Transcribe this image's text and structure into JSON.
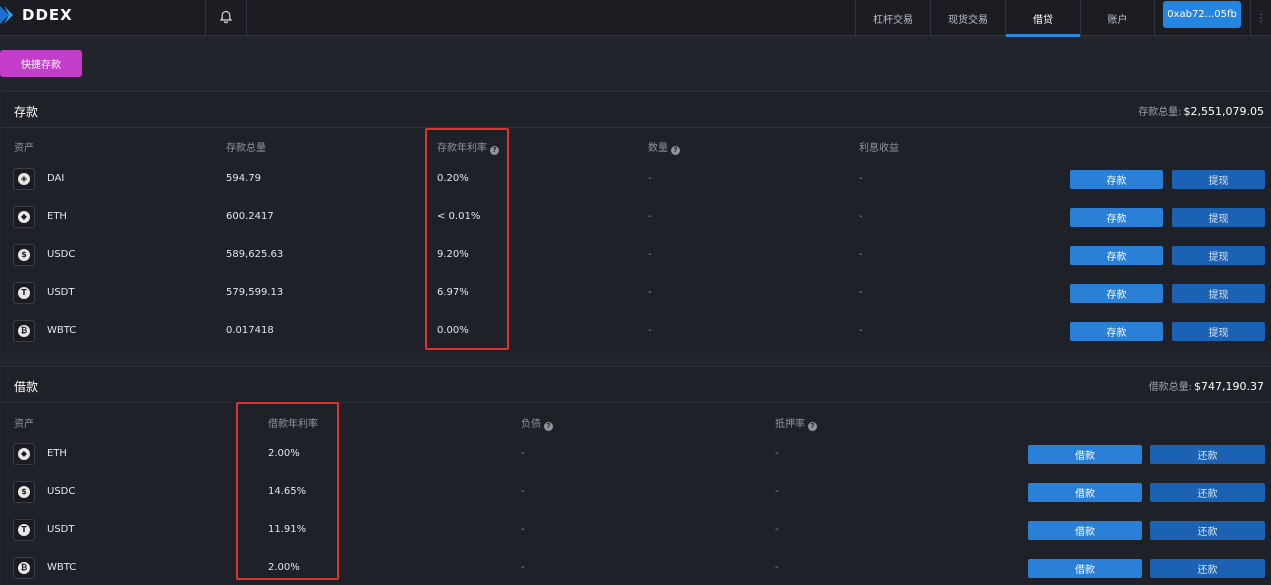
{
  "app": {
    "brand": "DDEX",
    "wallet_address": "0xab72...05fb",
    "brand_colors": {
      "accent": "#2585e3",
      "quick_button": "#c23ec8",
      "highlight_box": "#e0312f"
    }
  },
  "nav": {
    "items": [
      {
        "label": "杠杆交易",
        "active": false
      },
      {
        "label": "现货交易",
        "active": false
      },
      {
        "label": "借贷",
        "active": true
      },
      {
        "label": "账户",
        "active": false
      }
    ]
  },
  "quick_deposit_label": "快捷存款",
  "icons": {
    "bell": "bell-icon",
    "help": "question-circle-icon",
    "coins": {
      "DAI": "dai-icon",
      "ETH": "eth-icon",
      "USDC": "usdc-icon",
      "USDT": "usdt-icon",
      "WBTC": "wbtc-icon"
    }
  },
  "deposits": {
    "title": "存款",
    "total_label": "存款总量:",
    "total_value": "$2,551,079.05",
    "headers": {
      "asset": "资产",
      "total": "存款总量",
      "apr": "存款年利率",
      "amount": "数量",
      "interest": "利息收益"
    },
    "deposit_label": "存款",
    "withdraw_label": "提现",
    "rows": [
      {
        "asset": "DAI",
        "glyph": "◈",
        "total": "594.79",
        "apr": "0.20%",
        "amount": "-",
        "interest": "-"
      },
      {
        "asset": "ETH",
        "glyph": "◆",
        "total": "600.2417",
        "apr": "< 0.01%",
        "amount": "-",
        "interest": "-"
      },
      {
        "asset": "USDC",
        "glyph": "$",
        "total": "589,625.63",
        "apr": "9.20%",
        "amount": "-",
        "interest": "-"
      },
      {
        "asset": "USDT",
        "glyph": "T",
        "total": "579,599.13",
        "apr": "6.97%",
        "amount": "-",
        "interest": "-"
      },
      {
        "asset": "WBTC",
        "glyph": "₿",
        "total": "0.017418",
        "apr": "0.00%",
        "amount": "-",
        "interest": "-"
      }
    ]
  },
  "loans": {
    "title": "借款",
    "total_label": "借款总量:",
    "total_value": "$747,190.37",
    "headers": {
      "asset": "资产",
      "apr": "借款年利率",
      "debt": "负债",
      "collateral": "抵押率"
    },
    "borrow_label": "借款",
    "repay_label": "还款",
    "rows": [
      {
        "asset": "ETH",
        "glyph": "◆",
        "apr": "2.00%",
        "debt": "-",
        "collateral": "-"
      },
      {
        "asset": "USDC",
        "glyph": "$",
        "apr": "14.65%",
        "debt": "-",
        "collateral": "-"
      },
      {
        "asset": "USDT",
        "glyph": "T",
        "apr": "11.91%",
        "debt": "-",
        "collateral": "-"
      },
      {
        "asset": "WBTC",
        "glyph": "₿",
        "apr": "2.00%",
        "debt": "-",
        "collateral": "-"
      }
    ]
  }
}
